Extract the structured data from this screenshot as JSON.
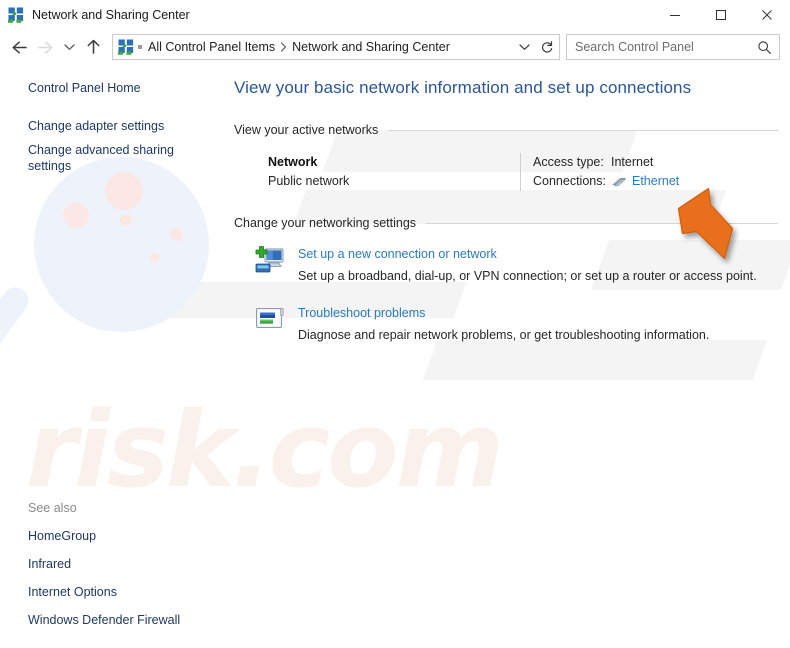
{
  "window": {
    "title": "Network and Sharing Center",
    "icon": "network-sharing-icon",
    "minimize_label": "Minimize",
    "maximize_label": "Maximize",
    "close_label": "Close"
  },
  "navbar": {
    "back_label": "Back",
    "forward_label": "Forward",
    "recent_label": "Recent locations",
    "up_label": "Up",
    "breadcrumbs": [
      {
        "label": "All Control Panel Items"
      },
      {
        "label": "Network and Sharing Center"
      }
    ],
    "dropdown_label": "Previous locations",
    "refresh_label": "Refresh",
    "search": {
      "placeholder": "Search Control Panel",
      "value": ""
    }
  },
  "sidebar": {
    "items": [
      {
        "label": "Control Panel Home"
      },
      {
        "label": "Change adapter settings"
      },
      {
        "label": "Change advanced sharing settings"
      }
    ],
    "see_also_title": "See also",
    "see_also": [
      {
        "label": "HomeGroup"
      },
      {
        "label": "Infrared"
      },
      {
        "label": "Internet Options"
      },
      {
        "label": "Windows Defender Firewall"
      }
    ]
  },
  "main": {
    "heading": "View your basic network information and set up connections",
    "sections": [
      {
        "label": "View your active networks"
      },
      {
        "label": "Change your networking settings"
      }
    ],
    "active_network": {
      "name": "Network",
      "type": "Public network",
      "access_type_key": "Access type:",
      "access_type_value": "Internet",
      "connections_key": "Connections:",
      "connection_name": "Ethernet",
      "connection_icon": "ethernet-cable-icon"
    },
    "tasks": [
      {
        "icon": "new-connection-icon",
        "link": "Set up a new connection or network",
        "description": "Set up a broadband, dial-up, or VPN connection; or set up a router or access point."
      },
      {
        "icon": "troubleshoot-icon",
        "link": "Troubleshoot problems",
        "description": "Diagnose and repair network problems, or get troubleshooting information."
      }
    ]
  },
  "watermark": {
    "text": "risk.com",
    "magnifier_icon": "magnifier-watermark-icon"
  },
  "cursor": {
    "name": "orange-pointer-arrow",
    "color": "#e8701a"
  },
  "colors": {
    "heading_blue": "#2a5699",
    "link_blue": "#2a7ac1",
    "sidebar_link": "#1f3864",
    "text": "#262626",
    "rule": "#d6d6d6",
    "watermark_pink": "#fbf1ec",
    "watermark_blue": "#eef2fa",
    "cursor_orange": "#e8701a"
  }
}
